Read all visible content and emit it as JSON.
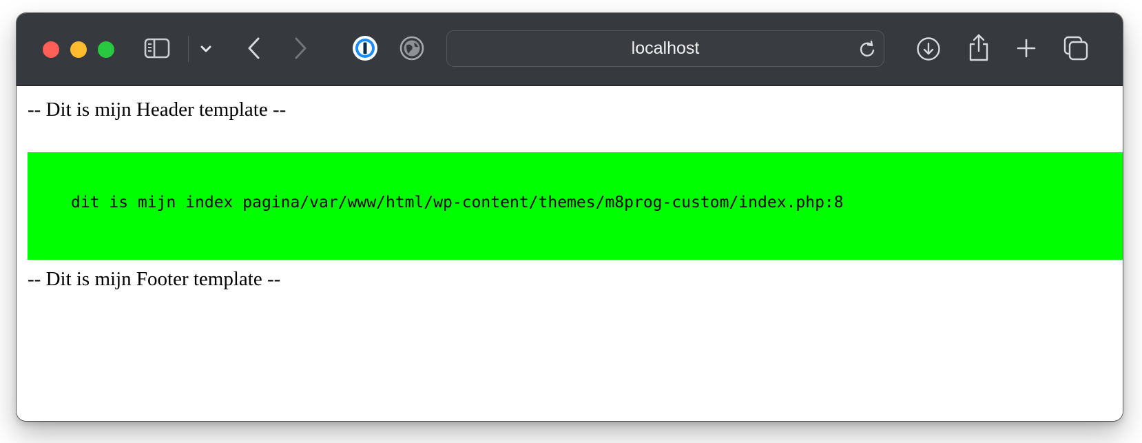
{
  "browser": {
    "address_bar": {
      "url": "localhost"
    },
    "toolbar_icons": [
      "sidebar-icon",
      "chevron-down-icon",
      "back-icon",
      "forward-icon",
      "password-manager-icon",
      "globe-icon",
      "reload-icon",
      "download-icon",
      "share-icon",
      "new-tab-icon",
      "tab-overview-icon"
    ],
    "traffic_light_colors": {
      "close": "#ff5f57",
      "minimize": "#febc2e",
      "maximize": "#28c840"
    }
  },
  "page": {
    "header_text": "-- Dit is mijn Header template --",
    "index_text": "dit is mijn index pagina/var/www/html/wp-content/themes/m8prog-custom/index.php:8",
    "footer_text": "-- Dit is mijn Footer template --",
    "index_background": "#00ff00"
  }
}
